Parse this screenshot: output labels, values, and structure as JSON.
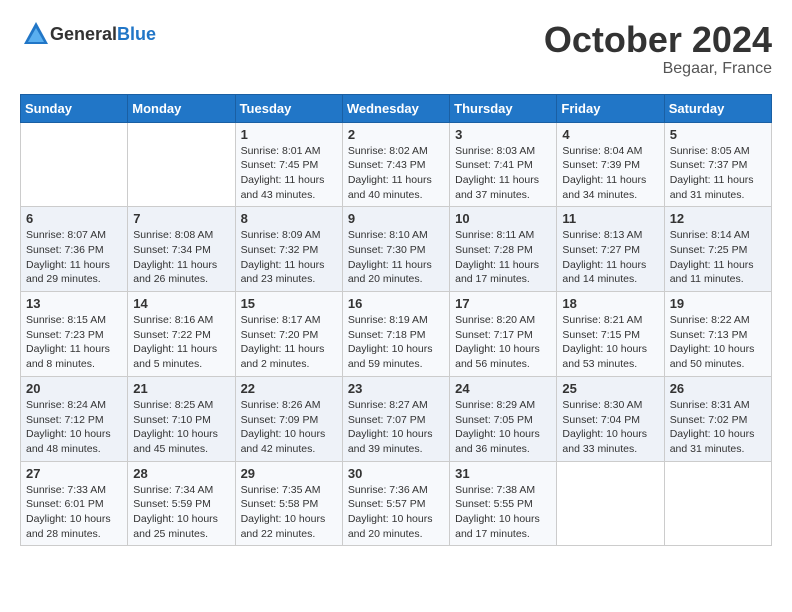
{
  "header": {
    "logo": {
      "general": "General",
      "blue": "Blue"
    },
    "month": "October 2024",
    "location": "Begaar, France"
  },
  "weekdays": [
    "Sunday",
    "Monday",
    "Tuesday",
    "Wednesday",
    "Thursday",
    "Friday",
    "Saturday"
  ],
  "weeks": [
    [
      {
        "day": "",
        "info": ""
      },
      {
        "day": "",
        "info": ""
      },
      {
        "day": "1",
        "info": "Sunrise: 8:01 AM\nSunset: 7:45 PM\nDaylight: 11 hours and 43 minutes."
      },
      {
        "day": "2",
        "info": "Sunrise: 8:02 AM\nSunset: 7:43 PM\nDaylight: 11 hours and 40 minutes."
      },
      {
        "day": "3",
        "info": "Sunrise: 8:03 AM\nSunset: 7:41 PM\nDaylight: 11 hours and 37 minutes."
      },
      {
        "day": "4",
        "info": "Sunrise: 8:04 AM\nSunset: 7:39 PM\nDaylight: 11 hours and 34 minutes."
      },
      {
        "day": "5",
        "info": "Sunrise: 8:05 AM\nSunset: 7:37 PM\nDaylight: 11 hours and 31 minutes."
      }
    ],
    [
      {
        "day": "6",
        "info": "Sunrise: 8:07 AM\nSunset: 7:36 PM\nDaylight: 11 hours and 29 minutes."
      },
      {
        "day": "7",
        "info": "Sunrise: 8:08 AM\nSunset: 7:34 PM\nDaylight: 11 hours and 26 minutes."
      },
      {
        "day": "8",
        "info": "Sunrise: 8:09 AM\nSunset: 7:32 PM\nDaylight: 11 hours and 23 minutes."
      },
      {
        "day": "9",
        "info": "Sunrise: 8:10 AM\nSunset: 7:30 PM\nDaylight: 11 hours and 20 minutes."
      },
      {
        "day": "10",
        "info": "Sunrise: 8:11 AM\nSunset: 7:28 PM\nDaylight: 11 hours and 17 minutes."
      },
      {
        "day": "11",
        "info": "Sunrise: 8:13 AM\nSunset: 7:27 PM\nDaylight: 11 hours and 14 minutes."
      },
      {
        "day": "12",
        "info": "Sunrise: 8:14 AM\nSunset: 7:25 PM\nDaylight: 11 hours and 11 minutes."
      }
    ],
    [
      {
        "day": "13",
        "info": "Sunrise: 8:15 AM\nSunset: 7:23 PM\nDaylight: 11 hours and 8 minutes."
      },
      {
        "day": "14",
        "info": "Sunrise: 8:16 AM\nSunset: 7:22 PM\nDaylight: 11 hours and 5 minutes."
      },
      {
        "day": "15",
        "info": "Sunrise: 8:17 AM\nSunset: 7:20 PM\nDaylight: 11 hours and 2 minutes."
      },
      {
        "day": "16",
        "info": "Sunrise: 8:19 AM\nSunset: 7:18 PM\nDaylight: 10 hours and 59 minutes."
      },
      {
        "day": "17",
        "info": "Sunrise: 8:20 AM\nSunset: 7:17 PM\nDaylight: 10 hours and 56 minutes."
      },
      {
        "day": "18",
        "info": "Sunrise: 8:21 AM\nSunset: 7:15 PM\nDaylight: 10 hours and 53 minutes."
      },
      {
        "day": "19",
        "info": "Sunrise: 8:22 AM\nSunset: 7:13 PM\nDaylight: 10 hours and 50 minutes."
      }
    ],
    [
      {
        "day": "20",
        "info": "Sunrise: 8:24 AM\nSunset: 7:12 PM\nDaylight: 10 hours and 48 minutes."
      },
      {
        "day": "21",
        "info": "Sunrise: 8:25 AM\nSunset: 7:10 PM\nDaylight: 10 hours and 45 minutes."
      },
      {
        "day": "22",
        "info": "Sunrise: 8:26 AM\nSunset: 7:09 PM\nDaylight: 10 hours and 42 minutes."
      },
      {
        "day": "23",
        "info": "Sunrise: 8:27 AM\nSunset: 7:07 PM\nDaylight: 10 hours and 39 minutes."
      },
      {
        "day": "24",
        "info": "Sunrise: 8:29 AM\nSunset: 7:05 PM\nDaylight: 10 hours and 36 minutes."
      },
      {
        "day": "25",
        "info": "Sunrise: 8:30 AM\nSunset: 7:04 PM\nDaylight: 10 hours and 33 minutes."
      },
      {
        "day": "26",
        "info": "Sunrise: 8:31 AM\nSunset: 7:02 PM\nDaylight: 10 hours and 31 minutes."
      }
    ],
    [
      {
        "day": "27",
        "info": "Sunrise: 7:33 AM\nSunset: 6:01 PM\nDaylight: 10 hours and 28 minutes."
      },
      {
        "day": "28",
        "info": "Sunrise: 7:34 AM\nSunset: 5:59 PM\nDaylight: 10 hours and 25 minutes."
      },
      {
        "day": "29",
        "info": "Sunrise: 7:35 AM\nSunset: 5:58 PM\nDaylight: 10 hours and 22 minutes."
      },
      {
        "day": "30",
        "info": "Sunrise: 7:36 AM\nSunset: 5:57 PM\nDaylight: 10 hours and 20 minutes."
      },
      {
        "day": "31",
        "info": "Sunrise: 7:38 AM\nSunset: 5:55 PM\nDaylight: 10 hours and 17 minutes."
      },
      {
        "day": "",
        "info": ""
      },
      {
        "day": "",
        "info": ""
      }
    ]
  ]
}
